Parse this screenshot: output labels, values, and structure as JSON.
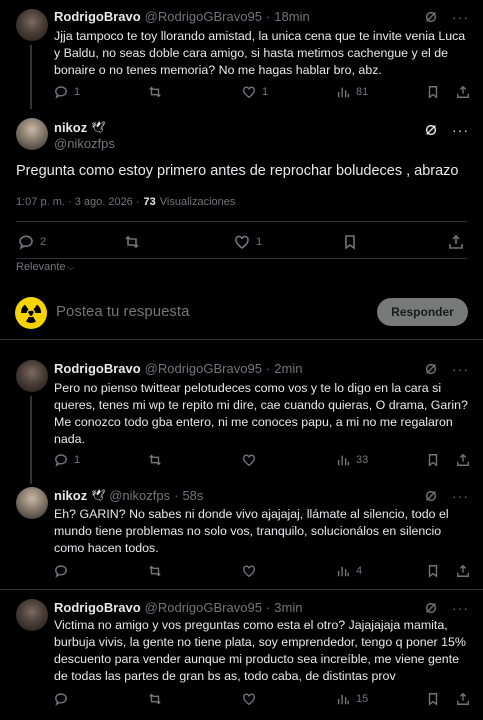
{
  "tweets": [
    {
      "name": "RodrigoBravo",
      "handle": "@RodrigoGBravo95",
      "time": "18min",
      "text": "Jjja tampoco te toy llorando amistad, la unica cena que te invite venia Luca y Baldu, no seas doble cara amigo, si hasta metimos cachengue y el de bonaire o no tenes memoria? No me hagas hablar bro, abz.",
      "replies": "1",
      "retweets": "",
      "likes": "1",
      "views": "81"
    }
  ],
  "main": {
    "name": "nikoz",
    "badge": "🕊",
    "handle": "@nikozfps",
    "text": "Pregunta como estoy primero antes de reprochar boludeces , abrazo",
    "timestamp": "1:07 p. m. · 3 ago. 2026 ·",
    "views_count": "73",
    "views_label": "Visualizaciones",
    "replies": "2",
    "retweets": "",
    "likes": "1"
  },
  "sort": {
    "label": "Relevante"
  },
  "compose": {
    "placeholder": "Postea tu respuesta",
    "button": "Responder"
  },
  "replies": [
    {
      "name": "RodrigoBravo",
      "handle": "@RodrigoGBravo95",
      "time": "2min",
      "text": "Pero no pienso twittear pelotudeces como vos y te lo digo en la cara si queres, tenes mi wp te repito mi dire, cae cuando quieras, O drama, Garin? Me conozco todo gba entero, ni me conoces papu, a mi no me regalaron nada.",
      "replies": "1",
      "retweets": "",
      "likes": "",
      "views": "33"
    },
    {
      "name": "nikoz",
      "badge": "🕊",
      "handle": "@nikozfps",
      "time": "58s",
      "text": "Eh? GARIN? No sabes ni donde vivo ajajajaj, llámate al silencio, todo el mundo tiene problemas no solo vos, tranquilo, solucionálos en silencio como hacen todos.",
      "replies": "",
      "retweets": "",
      "likes": "",
      "views": "4"
    },
    {
      "name": "RodrigoBravo",
      "handle": "@RodrigoGBravo95",
      "time": "3min",
      "text": "Victima no amigo y vos preguntas como esta el otro? Jajajajaja mamita, burbuja vivis, la gente no tiene plata, soy emprendedor, tengo q poner 15% descuento para vender aunque mi producto sea increíble, me viene gente de todas las partes de gran bs as, todo caba, de distintas prov",
      "replies": "",
      "retweets": "",
      "likes": "",
      "views": "15"
    }
  ]
}
